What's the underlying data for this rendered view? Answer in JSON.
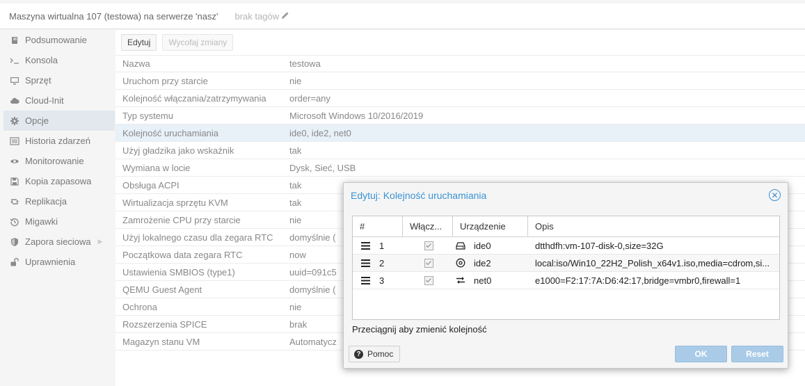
{
  "header": {
    "title": "Maszyna wirtualna 107 (testowa) na serwerze 'nasz'",
    "tags": "brak tagów"
  },
  "sidebar": {
    "items": [
      {
        "label": "Podsumowanie",
        "icon": "book-icon"
      },
      {
        "label": "Konsola",
        "icon": "terminal-icon"
      },
      {
        "label": "Sprzęt",
        "icon": "monitor-icon"
      },
      {
        "label": "Cloud-Init",
        "icon": "cloud-icon"
      },
      {
        "label": "Opcje",
        "icon": "gear-icon"
      },
      {
        "label": "Historia zdarzeń",
        "icon": "list-icon"
      },
      {
        "label": "Monitorowanie",
        "icon": "eye-icon"
      },
      {
        "label": "Kopia zapasowa",
        "icon": "floppy-icon"
      },
      {
        "label": "Replikacja",
        "icon": "retweet-icon"
      },
      {
        "label": "Migawki",
        "icon": "history-icon"
      },
      {
        "label": "Zapora sieciowa",
        "icon": "shield-icon"
      },
      {
        "label": "Uprawnienia",
        "icon": "unlock-icon"
      }
    ]
  },
  "toolbar": {
    "edit_label": "Edytuj",
    "revert_label": "Wycofaj zmiany"
  },
  "options": [
    {
      "key": "Nazwa",
      "value": "testowa"
    },
    {
      "key": "Uruchom przy starcie",
      "value": "nie"
    },
    {
      "key": "Kolejność włączania/zatrzymywania",
      "value": "order=any"
    },
    {
      "key": "Typ systemu",
      "value": "Microsoft Windows 10/2016/2019"
    },
    {
      "key": "Kolejność uruchamiania",
      "value": "ide0, ide2, net0"
    },
    {
      "key": "Użyj gładzika jako wskaźnik",
      "value": "tak"
    },
    {
      "key": "Wymiana w locie",
      "value": "Dysk, Sieć, USB"
    },
    {
      "key": "Obsługa ACPI",
      "value": "tak"
    },
    {
      "key": "Wirtualizacja sprzętu KVM",
      "value": "tak"
    },
    {
      "key": "Zamrożenie CPU przy starcie",
      "value": "nie"
    },
    {
      "key": "Użyj lokalnego czasu dla zegara RTC",
      "value": "domyślnie ("
    },
    {
      "key": "Początkowa data zegara RTC",
      "value": "now"
    },
    {
      "key": "Ustawienia SMBIOS (type1)",
      "value": "uuid=091c5"
    },
    {
      "key": "QEMU Guest Agent",
      "value": "domyślnie ("
    },
    {
      "key": "Ochrona",
      "value": "nie"
    },
    {
      "key": "Rozszerzenia SPICE",
      "value": "brak"
    },
    {
      "key": "Magazyn stanu VM",
      "value": "Automatycz"
    }
  ],
  "dialog": {
    "title": "Edytuj: Kolejność uruchamiania",
    "columns": {
      "num": "#",
      "enabled": "Włącz...",
      "device": "Urządzenie",
      "description": "Opis"
    },
    "rows": [
      {
        "num": "1",
        "enabled": true,
        "device": "ide0",
        "device_icon": "hdd-icon",
        "description": "dtthdfh:vm-107-disk-0,size=32G"
      },
      {
        "num": "2",
        "enabled": true,
        "device": "ide2",
        "device_icon": "cdrom-icon",
        "description": "local:iso/Win10_22H2_Polish_x64v1.iso,media=cdrom,si..."
      },
      {
        "num": "3",
        "enabled": true,
        "device": "net0",
        "device_icon": "exchange-icon",
        "description": "e1000=F2:17:7A:D6:42:17,bridge=vmbr0,firewall=1"
      }
    ],
    "hint": "Przeciągnij aby zmienić kolejność",
    "help_label": "Pomoc",
    "ok_label": "OK",
    "reset_label": "Reset"
  },
  "colors": {
    "accent": "#3892d4",
    "selected_row": "#e8f0f8",
    "active_nav": "#e2e8ee",
    "primary_button_disabled": "#a9cbe8"
  }
}
